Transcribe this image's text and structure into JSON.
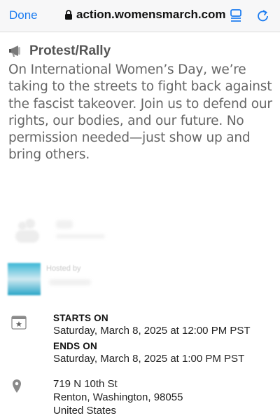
{
  "browser": {
    "done_label": "Done",
    "url": "action.womensmarch.com",
    "accent_color": "#1a7bf0"
  },
  "event": {
    "category_icon": "megaphone-icon",
    "title": "Protest/Rally",
    "description": "On International Women’s Day, we’re taking to the streets to fight back against the fascist takeover. Join us to defend our rights, our bodies, and our future. No permission needed—just show up and bring others.",
    "hosted_by_label": "Hosted by",
    "starts_label": "STARTS ON",
    "starts_value": "Saturday, March 8, 2025 at 12:00 PM PST",
    "ends_label": "ENDS ON",
    "ends_value": "Saturday, March 8, 2025 at 1:00 PM PST",
    "address_line1": "719 N 10th St",
    "address_line2": "Renton, Washington, 98055",
    "address_line3": "United States"
  }
}
